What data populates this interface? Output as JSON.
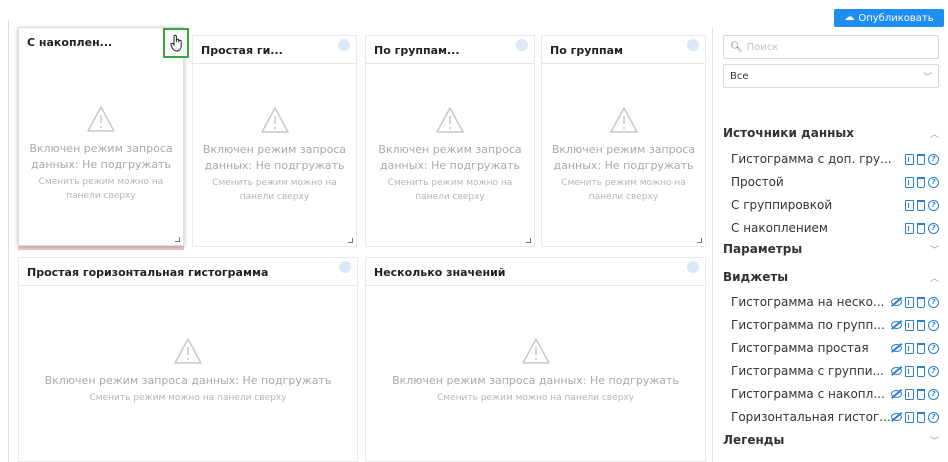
{
  "header": {
    "publish_label": "Опубликовать"
  },
  "widgets": [
    {
      "title": "С накоплен...",
      "message": "Включен режим запроса данных: Не подгружать",
      "hint": "Сменить режим можно на панели сверху"
    },
    {
      "title": "Простая ги...",
      "message": "Включен режим запроса данных: Не подгружать",
      "hint": "Сменить режим можно на панели сверху"
    },
    {
      "title": "По группам...",
      "message": "Включен режим запроса данных: Не подгружать",
      "hint": "Сменить режим можно на панели сверху"
    },
    {
      "title": "По группам",
      "message": "Включен режим запроса данных: Не подгружать",
      "hint": "Сменить режим можно на панели сверху"
    },
    {
      "title": "Простая горизонтальная гистограмма",
      "message": "Включен режим запроса данных: Не подгружать",
      "hint": "Сменить режим можно на панели сверху"
    },
    {
      "title": "Несколько значений",
      "message": "Включен режим запроса данных: Не подгружать",
      "hint": "Сменить режим можно на панели сверху"
    }
  ],
  "panel": {
    "search_placeholder": "Поиск",
    "filter_value": "Все",
    "sections": {
      "sources": "Источники данных",
      "params": "Параметры",
      "widgets": "Виджеты",
      "legends": "Легенды"
    },
    "sources": [
      {
        "label": "Гистограмма с доп. гру..."
      },
      {
        "label": "Простой"
      },
      {
        "label": "С группировкой"
      },
      {
        "label": "С накоплением"
      }
    ],
    "widget_items": [
      {
        "label": "Гистограмма на неско..."
      },
      {
        "label": "Гистограмма по групп..."
      },
      {
        "label": "Гистограмма простая"
      },
      {
        "label": "Гистограмма с группи..."
      },
      {
        "label": "Гистограмма с накопл..."
      },
      {
        "label": "Горизонтальная гистог..."
      }
    ]
  },
  "colors": {
    "accent": "#1f8ef1",
    "action_icon": "#2a7fd4",
    "drag_highlight": "#3aa645"
  }
}
